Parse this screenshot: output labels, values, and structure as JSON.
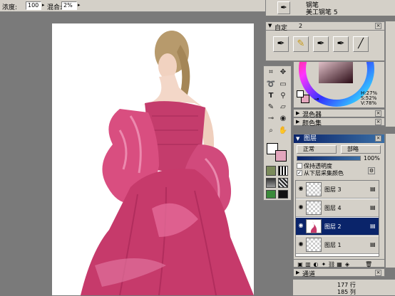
{
  "options_bar": {
    "opacity_label": "浓度:",
    "opacity_value": "100",
    "blend_label": "混合:",
    "blend_value": "2%"
  },
  "brush_list": {
    "item1": "钢笔",
    "item2": "美工钢笔 5"
  },
  "custom_panel": {
    "title": "自定",
    "number": "2"
  },
  "color_panel": {
    "hsv_h": "H:27%",
    "hsv_s": "S:52%",
    "hsv_v": "V:78%",
    "fg_color": "#e3a6bd",
    "bg_color": "#ffffff"
  },
  "collapsed_panels": {
    "mixer": "混色器",
    "color_set": "颜色集"
  },
  "layers_panel": {
    "title": "图层",
    "blend_mode": "正常",
    "composite": "部略",
    "opacity": "100%",
    "preserve_transparency": "保持透明度",
    "sample_below": "从下层采集颜色",
    "layers": [
      {
        "name": "图层 3",
        "selected": false
      },
      {
        "name": "图层 4",
        "selected": false
      },
      {
        "name": "图层 2",
        "selected": true
      },
      {
        "name": "图层 1",
        "selected": false
      }
    ]
  },
  "channels_panel": {
    "title": "通道"
  },
  "status": {
    "row_info": "177 行",
    "col_info": "185 列"
  }
}
